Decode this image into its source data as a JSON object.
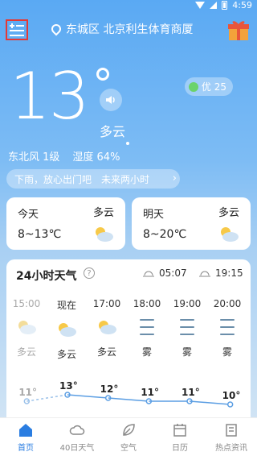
{
  "status": {
    "time": "4:59"
  },
  "header": {
    "location": "东城区 北京利生体育商厦"
  },
  "current": {
    "temperature": "13",
    "condition": "多云",
    "wind": "东北风 1级",
    "humidity": "湿度 64%",
    "aqi_label": "优 25",
    "tips": [
      "下雨，放心出门吧",
      "未来两小时"
    ]
  },
  "days": [
    {
      "label": "今天",
      "condition": "多云",
      "range": "8~13℃"
    },
    {
      "label": "明天",
      "condition": "多云",
      "range": "8~20℃"
    }
  ],
  "hourly_panel": {
    "title": "24小时天气",
    "sunrise": "05:07",
    "sunset": "19:15",
    "hours": [
      {
        "time": "15:00",
        "condition": "多云",
        "temp": "11°",
        "past": true,
        "icon": "partly-cloudy-icon"
      },
      {
        "time": "现在",
        "condition": "多云",
        "temp": "13°",
        "past": false,
        "icon": "partly-cloudy-icon"
      },
      {
        "time": "17:00",
        "condition": "多云",
        "temp": "12°",
        "past": false,
        "icon": "partly-cloudy-icon"
      },
      {
        "time": "18:00",
        "condition": "雾",
        "temp": "11°",
        "past": false,
        "icon": "fog-icon"
      },
      {
        "time": "19:00",
        "condition": "雾",
        "temp": "11°",
        "past": false,
        "icon": "fog-icon"
      },
      {
        "time": "20:00",
        "condition": "雾",
        "temp": "10°",
        "past": false,
        "icon": "fog-icon"
      }
    ]
  },
  "tabs": [
    {
      "label": "首页",
      "active": true
    },
    {
      "label": "40日天气",
      "active": false
    },
    {
      "label": "空气",
      "active": false
    },
    {
      "label": "日历",
      "active": false
    },
    {
      "label": "热点资讯",
      "active": false
    }
  ],
  "colors": {
    "accent": "#2a7de1",
    "aqi_good": "#6bd36b",
    "highlight_border": "#e53935"
  }
}
